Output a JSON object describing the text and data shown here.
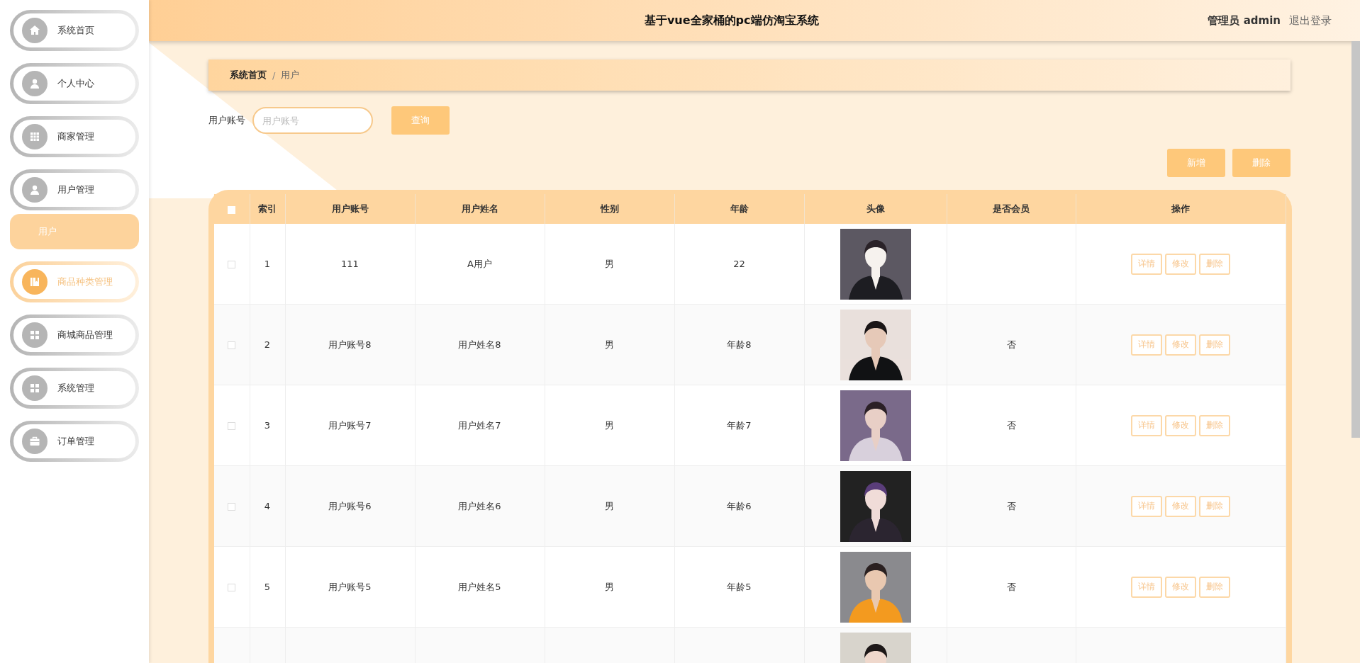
{
  "header": {
    "title": "基于vue全家桶的pc端仿淘宝系统",
    "user": "管理员 admin",
    "logout": "退出登录"
  },
  "sidebar": {
    "items": [
      {
        "label": "系统首页",
        "hovered": false
      },
      {
        "label": "个人中心",
        "hovered": false
      },
      {
        "label": "商家管理",
        "hovered": false
      },
      {
        "label": "用户管理",
        "hovered": false,
        "expanded": true,
        "children": [
          {
            "label": "用户",
            "selected": true
          }
        ]
      },
      {
        "label": "商品种类管理",
        "hovered": true
      },
      {
        "label": "商城商品管理",
        "hovered": false
      },
      {
        "label": "系统管理",
        "hovered": false
      },
      {
        "label": "订单管理",
        "hovered": false
      }
    ]
  },
  "breadcrumb": {
    "items": [
      "系统首页",
      "用户"
    ],
    "separator": "/"
  },
  "search": {
    "label": "用户账号",
    "placeholder": "用户账号",
    "button": "查询"
  },
  "toolbar": [
    "新增",
    "删除"
  ],
  "table": {
    "select_all": false,
    "columns": [
      "索引",
      "用户账号",
      "用户姓名",
      "性别",
      "年龄",
      "头像",
      "是否会员",
      "操作"
    ],
    "rows": [
      {
        "checked": false,
        "index": "1",
        "account": "111",
        "name": "A用户",
        "gender": "男",
        "age": "22",
        "avatar": {
          "kind": "picture"
        },
        "actions": [
          "详情",
          "修改",
          "删除"
        ]
      },
      {
        "checked": false,
        "index": "2",
        "account": "用户账号8",
        "name": "用户姓名8",
        "gender": "男",
        "age": "年龄8",
        "avatar": {
          "kind": "picture"
        },
        "member": "否",
        "actions": [
          "详情",
          "修改",
          "删除"
        ]
      },
      {
        "checked": false,
        "index": "3",
        "account": "用户账号7",
        "name": "用户姓名7",
        "gender": "男",
        "age": "年龄7",
        "avatar": {
          "kind": "picture"
        },
        "member": "否",
        "actions": [
          "详情",
          "修改",
          "删除"
        ]
      },
      {
        "checked": false,
        "index": "4",
        "account": "用户账号6",
        "name": "用户姓名6",
        "gender": "男",
        "age": "年龄6",
        "avatar": {
          "kind": "picture"
        },
        "member": "否",
        "actions": [
          "详情",
          "修改",
          "删除"
        ]
      },
      {
        "checked": false,
        "index": "5",
        "account": "用户账号5",
        "name": "用户姓名5",
        "gender": "男",
        "age": "年龄5",
        "avatar": {
          "kind": "picture"
        },
        "member": "否",
        "actions": [
          "详情",
          "修改",
          "删除"
        ]
      },
      {
        "avatar": {
          "kind": "picture"
        }
      }
    ]
  }
}
